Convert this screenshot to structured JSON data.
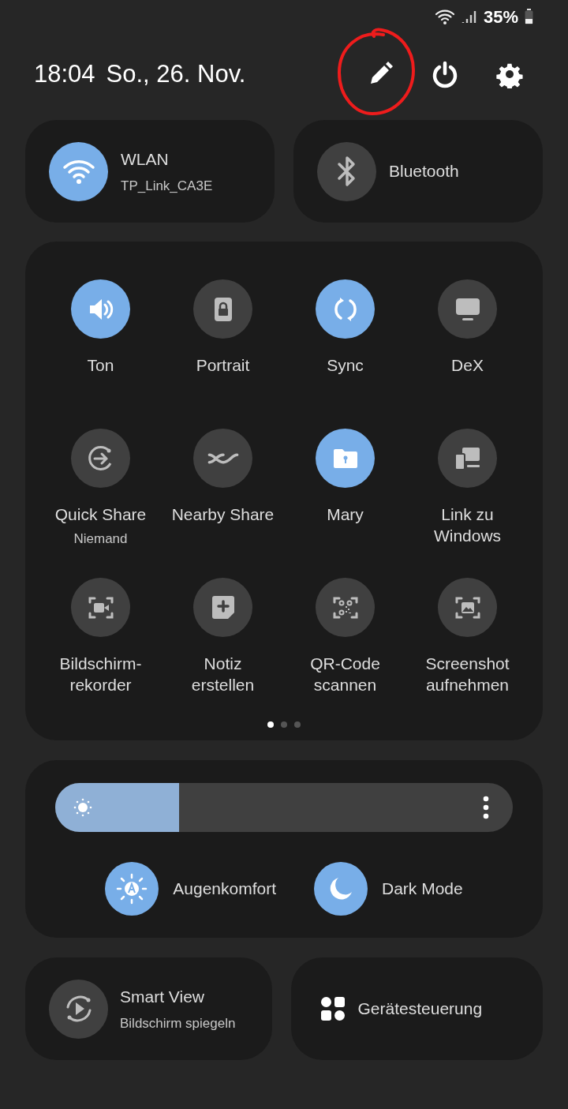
{
  "status_bar": {
    "battery": "35%"
  },
  "header": {
    "time": "18:04",
    "date": "So., 26. Nov."
  },
  "quick_toggles": [
    {
      "label": "WLAN",
      "subtitle": "TP_Link_CA3E",
      "on": true
    },
    {
      "label": "Bluetooth",
      "on": false
    }
  ],
  "tiles": [
    {
      "label": "Ton",
      "on": true
    },
    {
      "label": "Portrait",
      "on": false
    },
    {
      "label": "Sync",
      "on": true
    },
    {
      "label": "DeX",
      "on": false
    },
    {
      "label": "Quick Share",
      "subtitle": "Niemand",
      "on": false
    },
    {
      "label": "Nearby Share",
      "on": false
    },
    {
      "label": "Mary",
      "on": true
    },
    {
      "label": "Link zu\nWindows",
      "on": false
    },
    {
      "label": "Bildschirm-\nrekorder",
      "on": false
    },
    {
      "label": "Notiz\nerstellen",
      "on": false
    },
    {
      "label": "QR-Code\nscannen",
      "on": false
    },
    {
      "label": "Screenshot\naufnehmen",
      "on": false
    }
  ],
  "page_dots": [
    {
      "selected": true
    },
    {
      "selected": false
    },
    {
      "selected": false
    }
  ],
  "brightness": {
    "level": 0.27
  },
  "display_toggles": [
    {
      "label": "Augenkomfort",
      "on": true
    },
    {
      "label": "Dark Mode",
      "on": true
    }
  ],
  "smart_view": {
    "title": "Smart View",
    "subtitle": "Bildschirm spiegeln"
  },
  "device_control": {
    "label": "Gerätesteuerung"
  }
}
